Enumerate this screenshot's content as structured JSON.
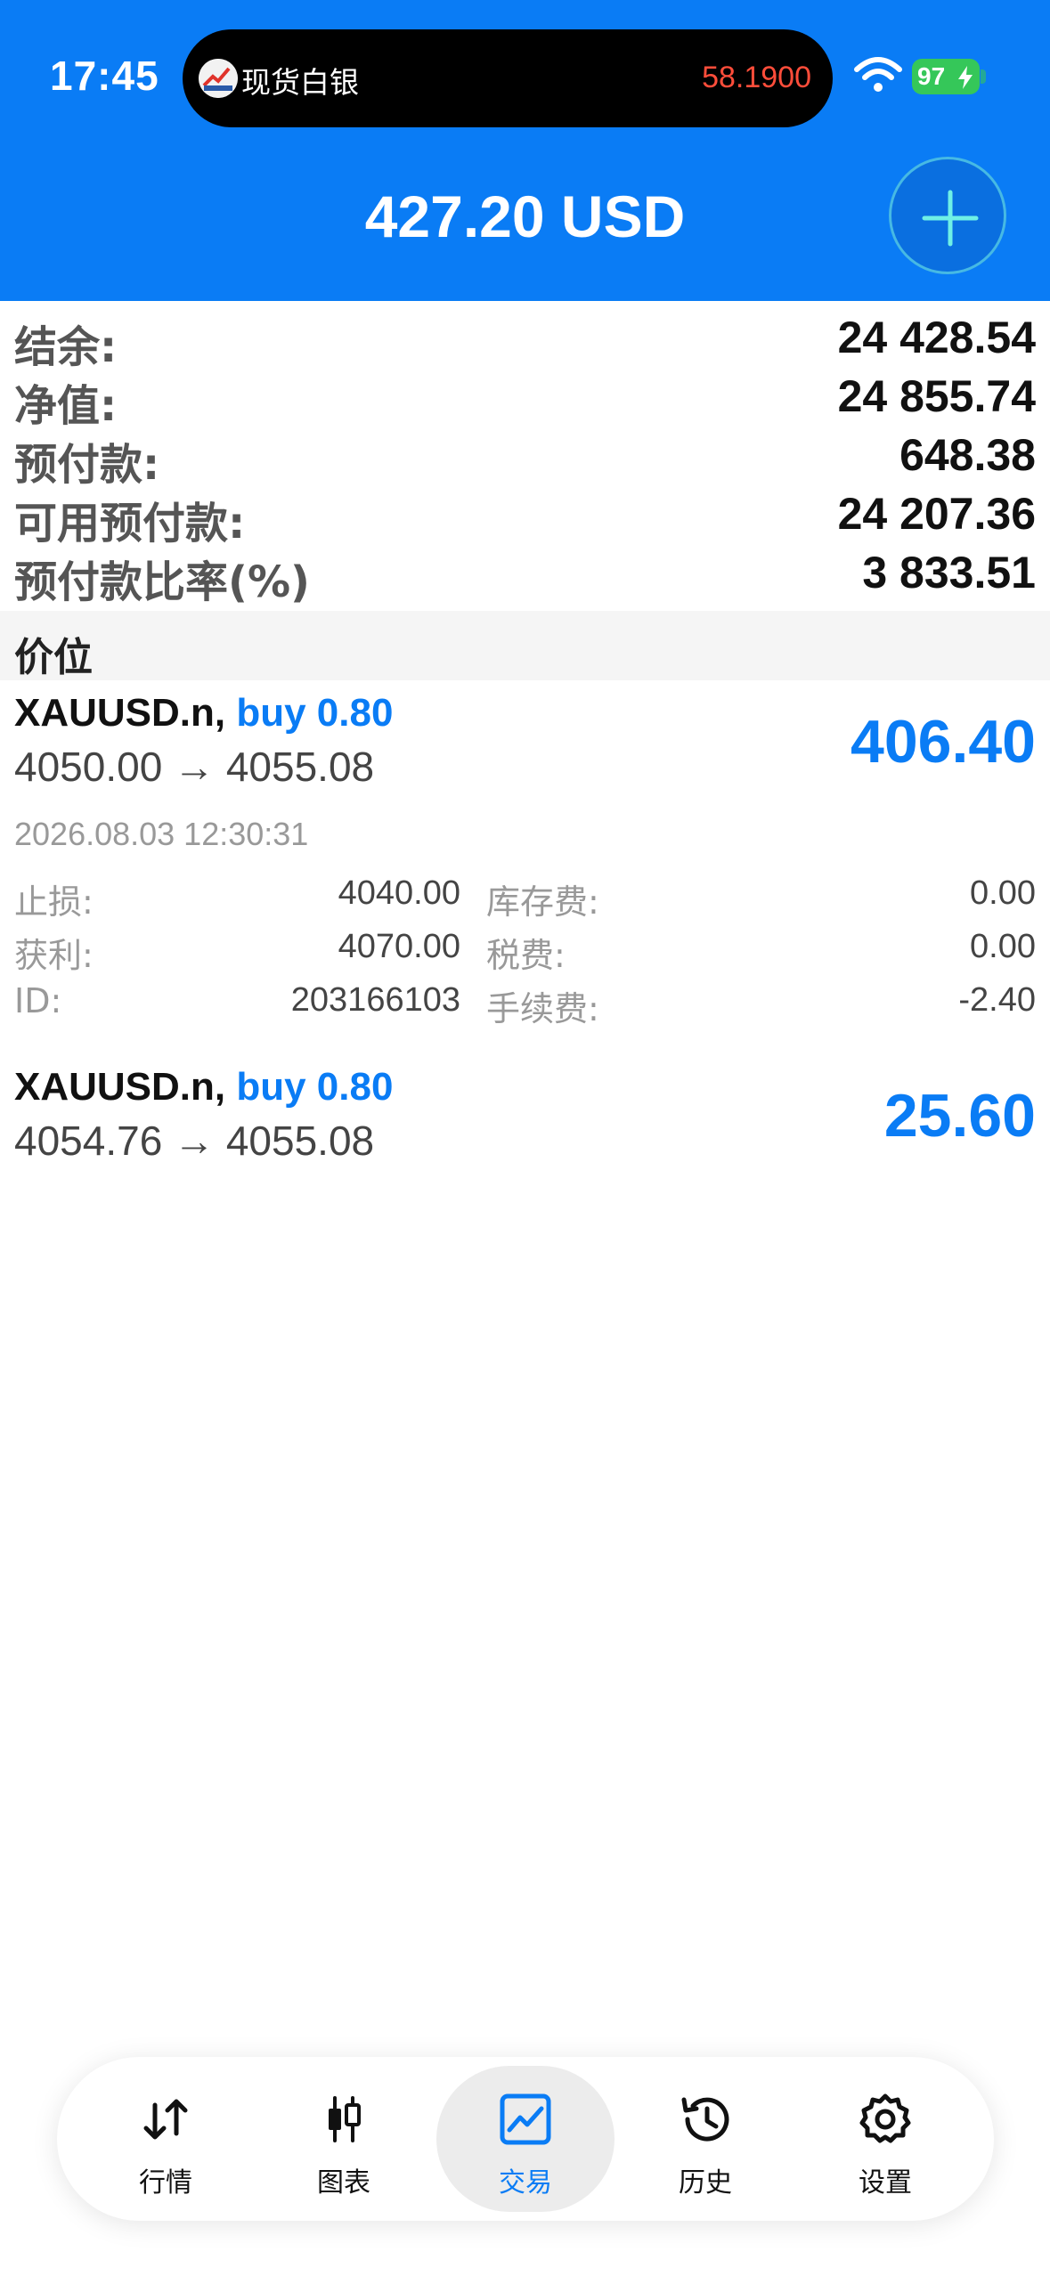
{
  "status_bar": {
    "time": "17:45",
    "island_name": "现货白银",
    "island_price": "58.1900",
    "battery": "97"
  },
  "header": {
    "title": "427.20 USD"
  },
  "summary": [
    {
      "label": "结余:",
      "value": "24 428.54"
    },
    {
      "label": "净值:",
      "value": "24 855.74"
    },
    {
      "label": "预付款:",
      "value": "648.38"
    },
    {
      "label": "可用预付款:",
      "value": "24 207.36"
    },
    {
      "label": "预付款比率(%)",
      "value": "3 833.51"
    }
  ],
  "section": {
    "label": "价位"
  },
  "positions": [
    {
      "symbol": "XAUUSD.n,",
      "side": "buy 0.80",
      "prices": "4050.00 → 4055.08",
      "profit": "406.40",
      "time": "2026.08.03 12:30:31",
      "details": {
        "sl_label": "止损:",
        "sl_value": "4040.00",
        "tp_label": "获利:",
        "tp_value": "4070.00",
        "id_label": "ID:",
        "id_value": "203166103",
        "swap_label": "库存费:",
        "swap_value": "0.00",
        "tax_label": "税费:",
        "tax_value": "0.00",
        "fee_label": "手续费:",
        "fee_value": "-2.40"
      }
    },
    {
      "symbol": "XAUUSD.n,",
      "side": "buy 0.80",
      "prices": "4054.76 → 4055.08",
      "profit": "25.60"
    }
  ],
  "nav": [
    {
      "label": "行情",
      "icon": "arrows-updown-icon"
    },
    {
      "label": "图表",
      "icon": "candlestick-icon"
    },
    {
      "label": "交易",
      "icon": "trade-chart-icon",
      "active": true
    },
    {
      "label": "历史",
      "icon": "history-clock-icon"
    },
    {
      "label": "设置",
      "icon": "gear-icon"
    }
  ],
  "colors": {
    "accent": "#0a7cf5",
    "price_red": "#ff4d3a",
    "battery_green": "#35c759"
  }
}
